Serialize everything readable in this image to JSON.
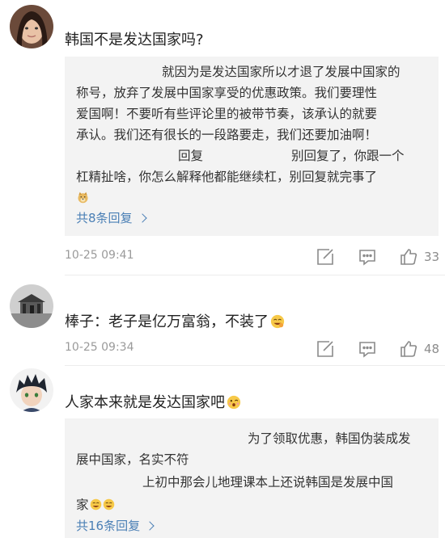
{
  "comments": [
    {
      "avatar": "girl-avatar",
      "text": "韩国不是发达国家吗?",
      "replies": {
        "lines": [
          "就因为是发达国家所以才退了发展中国家的",
          "称号，放弃了发展中国家享受的优惠政策。我们要理性",
          "爱国啊！不要听有些评论里的被带节奏，该承认的就要",
          "承认。我们还有很长的一段路要走，我们还要加油啊！",
          "回复",
          "别回复了，你跟一个",
          "杠精扯啥，你怎么解释他都能继续杠，别回复就完事了"
        ],
        "more_label": "共8条回复"
      },
      "time": "10-25 09:41",
      "likes": "33"
    },
    {
      "avatar": "house-avatar",
      "text": "棒子：老子是亿万富翁，不装了",
      "time": "10-25 09:34",
      "likes": "48"
    },
    {
      "avatar": "anime-avatar",
      "text": "人家本来就是发达国家吧",
      "replies": {
        "lines": [
          "为了领取优惠，韩国伪装成发",
          "展中国家，名实不符",
          "上初中那会儿地理课本上还说韩国是发展中国",
          "家"
        ],
        "more_label": "共16条回复"
      }
    }
  ],
  "colors": {
    "link": "#4a7fb5",
    "reply_bg": "#f3f3f3",
    "meta": "#9a9a9a"
  }
}
